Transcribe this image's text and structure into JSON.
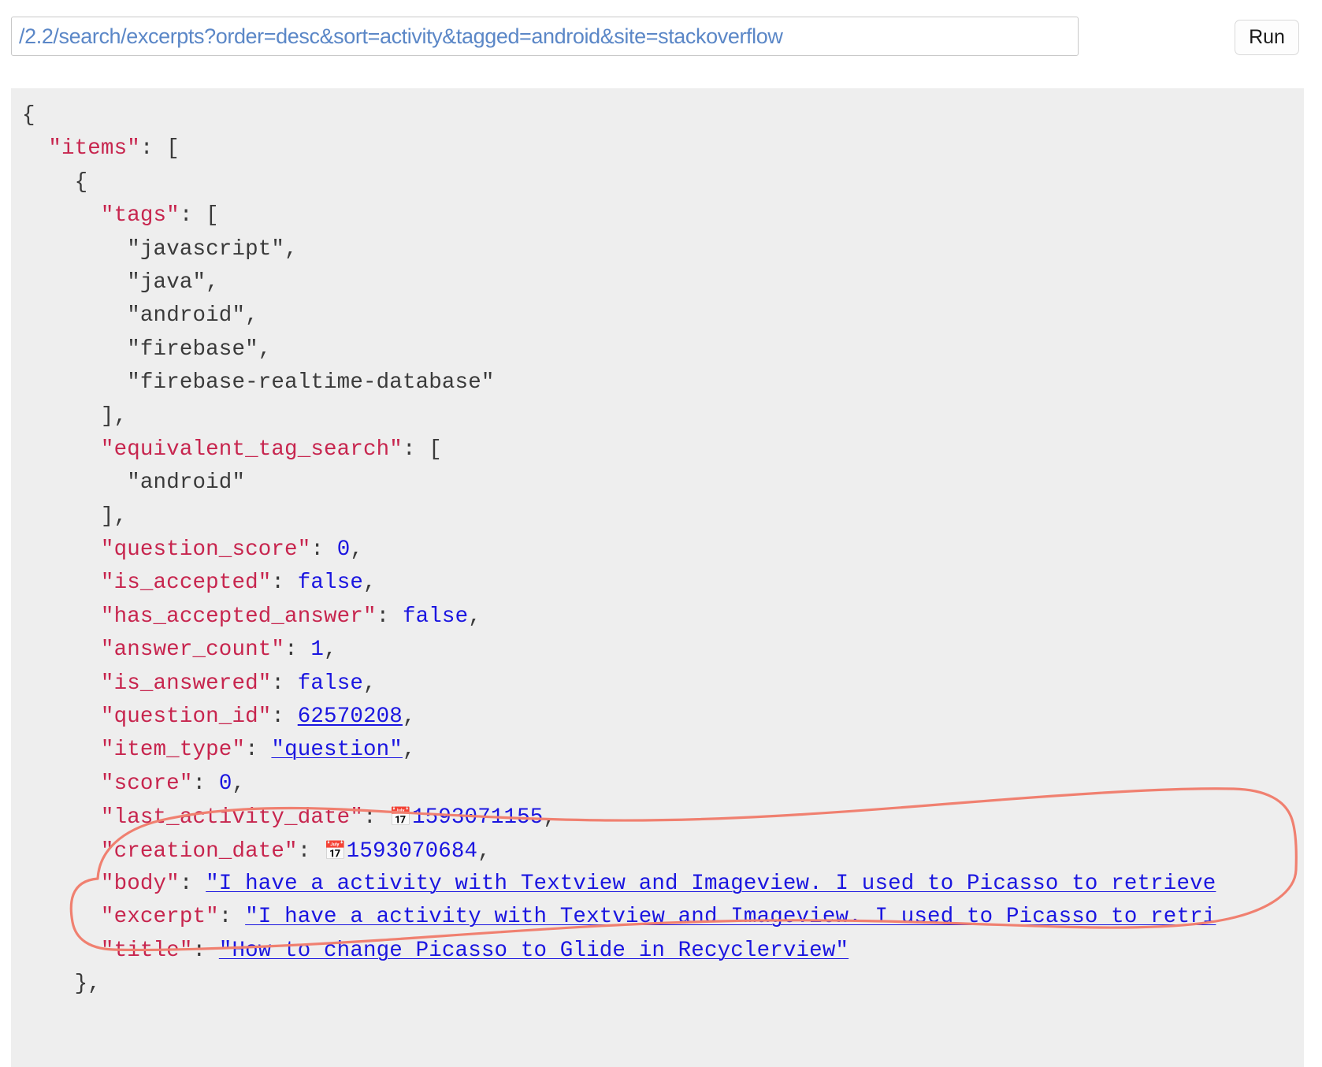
{
  "topbar": {
    "url_value": "/2.2/search/excerpts?order=desc&sort=activity&tagged=android&site=stackoverflow",
    "url_placeholder": "/2.2/search/excerpts",
    "run_label": "Run"
  },
  "response": {
    "format": "json",
    "calendar_icon": "📅",
    "lines": [
      {
        "indent": 0,
        "text": "{"
      },
      {
        "indent": 1,
        "key": "items",
        "text": "\"items\": ["
      },
      {
        "indent": 2,
        "text": "{"
      },
      {
        "indent": 3,
        "key": "tags",
        "text": "\"tags\": ["
      },
      {
        "indent": 4,
        "value": "javascript",
        "text": "\"javascript\","
      },
      {
        "indent": 4,
        "value": "java",
        "text": "\"java\","
      },
      {
        "indent": 4,
        "value": "android",
        "text": "\"android\","
      },
      {
        "indent": 4,
        "value": "firebase",
        "text": "\"firebase\","
      },
      {
        "indent": 4,
        "value": "firebase-realtime-database",
        "text": "\"firebase-realtime-database\""
      },
      {
        "indent": 3,
        "text": "],"
      },
      {
        "indent": 3,
        "key": "equivalent_tag_search",
        "text": "\"equivalent_tag_search\": ["
      },
      {
        "indent": 4,
        "value": "android",
        "text": "\"android\""
      },
      {
        "indent": 3,
        "text": "],"
      },
      {
        "indent": 3,
        "key": "question_score",
        "value": "0",
        "text": "\"question_score\": 0,"
      },
      {
        "indent": 3,
        "key": "is_accepted",
        "value": "false",
        "text": "\"is_accepted\": false,"
      },
      {
        "indent": 3,
        "key": "has_accepted_answer",
        "value": "false",
        "text": "\"has_accepted_answer\": false,"
      },
      {
        "indent": 3,
        "key": "answer_count",
        "value": "1",
        "text": "\"answer_count\": 1,"
      },
      {
        "indent": 3,
        "key": "is_answered",
        "value": "false",
        "text": "\"is_answered\": false,"
      },
      {
        "indent": 3,
        "key": "question_id",
        "value": "62570208",
        "text": "\"question_id\": 62570208,"
      },
      {
        "indent": 3,
        "key": "item_type",
        "value": "question",
        "text": "\"item_type\": \"question\","
      },
      {
        "indent": 3,
        "key": "score",
        "value": "0",
        "text": "\"score\": 0,"
      },
      {
        "indent": 3,
        "key": "last_activity_date",
        "value": "1593071155",
        "text": "\"last_activity_date\": 1593071155,"
      },
      {
        "indent": 3,
        "key": "creation_date",
        "value": "1593070684",
        "text": "\"creation_date\": 1593070684,"
      },
      {
        "indent": 3,
        "key": "body",
        "value": "I have a activity with Textview and Imageview. I used to Picasso to retrieve",
        "text": "\"body\": \"I have a activity with Textview and Imageview. I used to Picasso to retrieve"
      },
      {
        "indent": 3,
        "key": "excerpt",
        "value": "I have a activity with Textview and Imageview. I used to Picasso to retri",
        "text": "\"excerpt\": \"I have a activity with Textview and Imageview. I used to Picasso to retri"
      },
      {
        "indent": 3,
        "key": "title",
        "value": "How to change Picasso to Glide in Recyclerview",
        "text": "\"title\": \"How to change Picasso to Glide in Recyclerview\""
      },
      {
        "indent": 2,
        "text": "},"
      }
    ]
  },
  "annotation": {
    "shape": "hand-drawn-ellipse",
    "color": "#f08070",
    "encircles": [
      "body",
      "excerpt"
    ]
  },
  "colors": {
    "key": "#c7254e",
    "string": "#1a15e0",
    "punctuation": "#3a3a3a",
    "panel_background": "#eeeeee",
    "url_text": "#5b87c7",
    "annotation": "#f08070"
  }
}
